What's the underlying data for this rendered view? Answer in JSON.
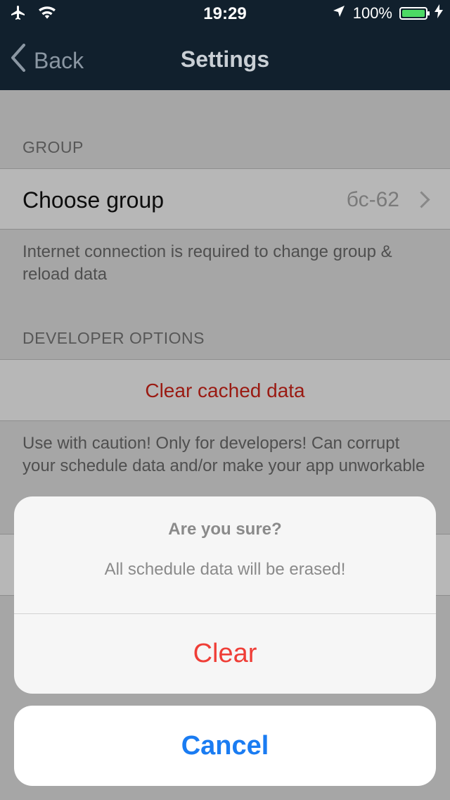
{
  "status_bar": {
    "time": "19:29",
    "battery_text": "100%",
    "icons": [
      "airplane-icon",
      "wifi-icon",
      "location-arrow-icon",
      "battery-icon",
      "charging-bolt-icon"
    ]
  },
  "nav": {
    "back_label": "Back",
    "title": "Settings"
  },
  "settings": {
    "group_section": {
      "header": "GROUP",
      "choose_group_label": "Choose group",
      "choose_group_value": "бс-62",
      "footer": "Internet connection is required to change group & reload data"
    },
    "developer_section": {
      "header": "DEVELOPER OPTIONS",
      "clear_cached_label": "Clear cached data",
      "footer": "Use with caution! Only for developers! Can corrupt your schedule data and/or make your app unworkable"
    }
  },
  "action_sheet": {
    "title": "Are you sure?",
    "message": "All schedule data will be erased!",
    "destructive_label": "Clear",
    "cancel_label": "Cancel"
  },
  "colors": {
    "nav_bar": "#11202d",
    "destructive": "#ef3e37",
    "cancel": "#1a7cf2",
    "battery": "#4cd964"
  }
}
